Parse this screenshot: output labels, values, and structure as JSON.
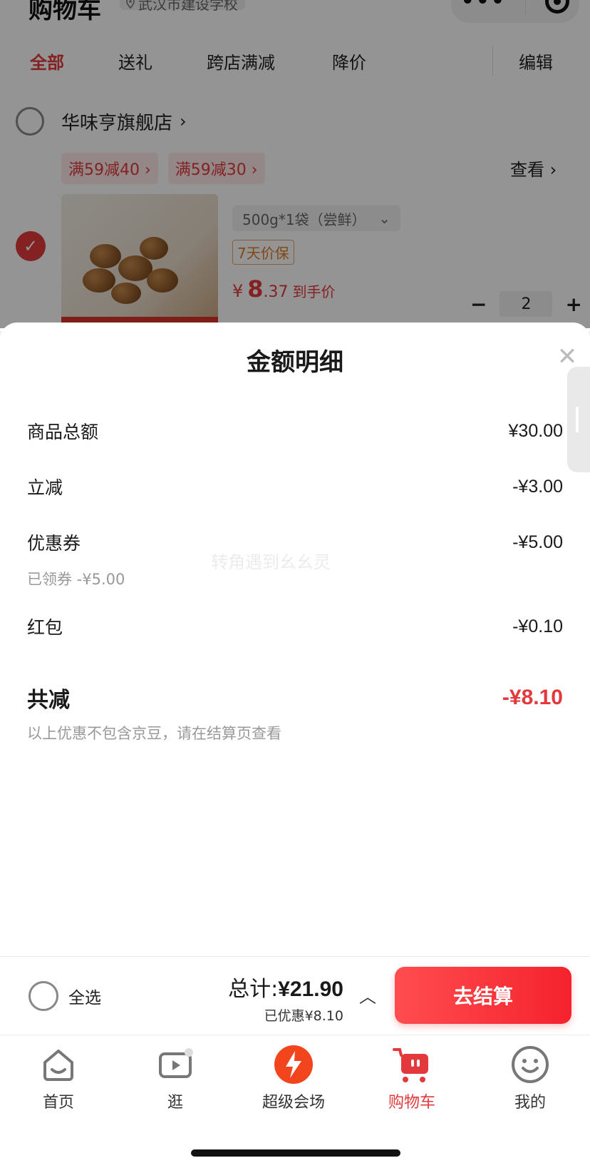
{
  "header": {
    "title": "购物车",
    "location": "武汉市建设学校"
  },
  "filter_tabs": [
    {
      "label": "全部",
      "active": true
    },
    {
      "label": "送礼",
      "active": false
    },
    {
      "label": "跨店满减",
      "active": false
    },
    {
      "label": "降价",
      "active": false
    }
  ],
  "edit_label": "编辑",
  "store": {
    "name": "华味亨旗舰店",
    "promos": [
      "满59减40",
      "满59减30"
    ],
    "view_label": "查看"
  },
  "product": {
    "spec": "500g*1袋（尝鲜）",
    "guarantee": "7天价保",
    "price_symbol": "¥",
    "price_int": "8",
    "price_dec": ".37",
    "price_note": "到手价",
    "quantity": "2"
  },
  "sheet": {
    "title": "金额明细",
    "watermark": "转角遇到幺幺灵",
    "lines": [
      {
        "label": "商品总额",
        "value": "¥30.00"
      },
      {
        "label": "立减",
        "value": "-¥3.00"
      },
      {
        "label": "优惠券",
        "value": "-¥5.00",
        "note": "已领券 -¥5.00"
      },
      {
        "label": "红包",
        "value": "-¥0.10"
      }
    ],
    "total_label": "共减",
    "total_value": "-¥8.10",
    "footnote": "以上优惠不包含京豆，请在结算页查看"
  },
  "checkout": {
    "select_all": "全选",
    "total_prefix": "总计:",
    "total_amount": "¥21.90",
    "saved": "已优惠¥8.10",
    "button": "去结算"
  },
  "tabbar": [
    {
      "label": "首页",
      "icon": "home-icon",
      "active": false
    },
    {
      "label": "逛",
      "icon": "video-icon",
      "active": false
    },
    {
      "label": "超级会场",
      "icon": "super-venue-icon",
      "active": false
    },
    {
      "label": "购物车",
      "icon": "cart-icon",
      "active": true
    },
    {
      "label": "我的",
      "icon": "smiley-icon",
      "active": false
    }
  ],
  "colors": {
    "accent": "#e4393c",
    "checkout_button": "#f5222d"
  }
}
